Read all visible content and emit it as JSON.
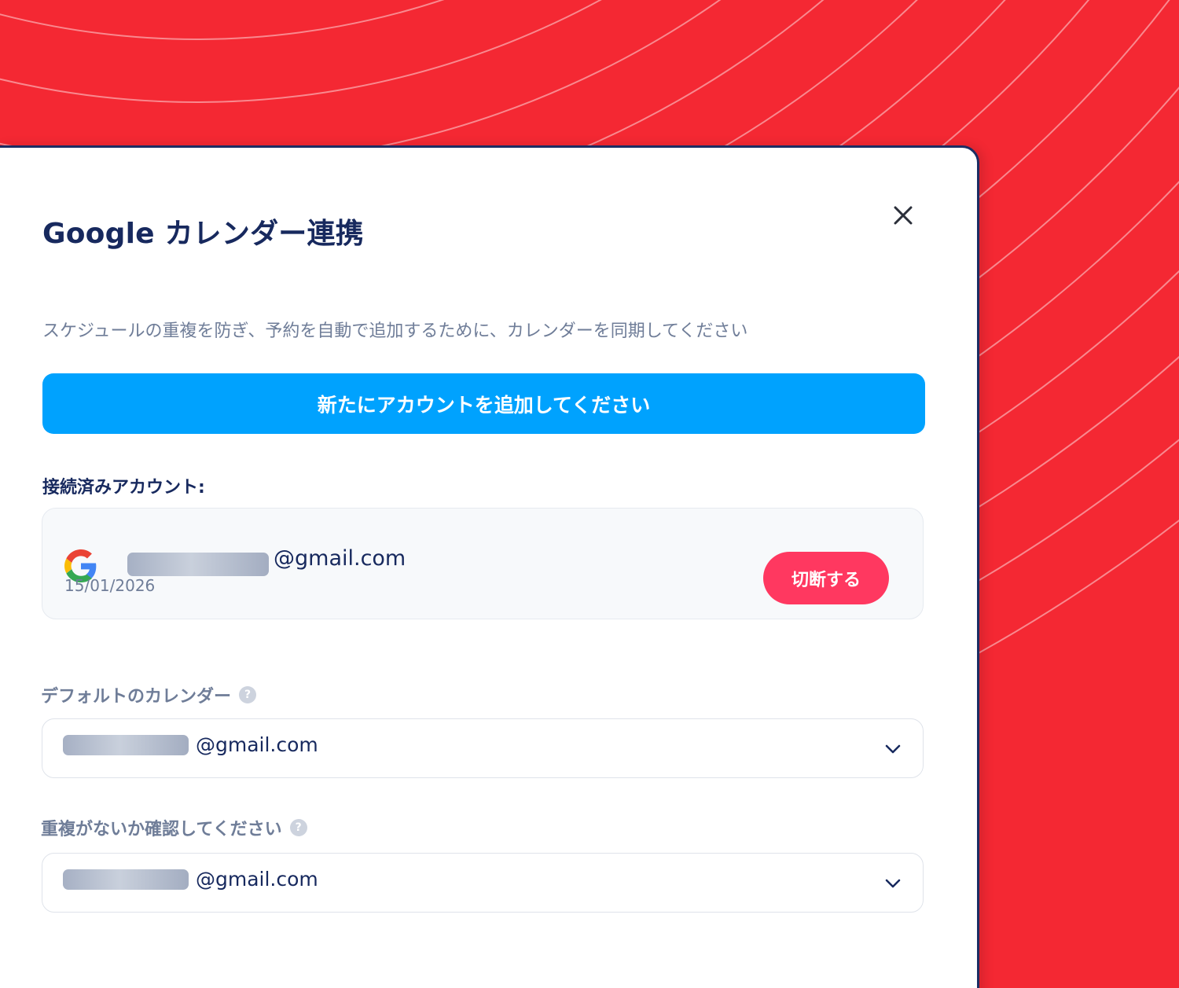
{
  "modal": {
    "title": "Google カレンダー連携",
    "subtitle": "スケジュールの重複を防ぎ、予約を自動で追加するために、カレンダーを同期してください",
    "add_account_label": "新たにアカウントを追加してください",
    "connected_label": "接続済みアカウント:",
    "account": {
      "email_suffix": "@gmail.com",
      "date": "15/01/2026",
      "disconnect_label": "切断する"
    },
    "default_calendar": {
      "label": "デフォルトのカレンダー",
      "selected_suffix": "@gmail.com"
    },
    "conflict_check": {
      "label": "重複がないか確認してください",
      "selected_suffix": "@gmail.com"
    },
    "help_glyph": "?"
  },
  "icons": {
    "close": "close-icon",
    "google": "google-logo-icon",
    "chevron": "chevron-down-icon",
    "help": "help-icon"
  },
  "colors": {
    "background": "#f42833",
    "title": "#17295e",
    "primary_button": "#00a2fe",
    "danger_button": "#ff3860",
    "muted_text": "#6f7d98"
  }
}
